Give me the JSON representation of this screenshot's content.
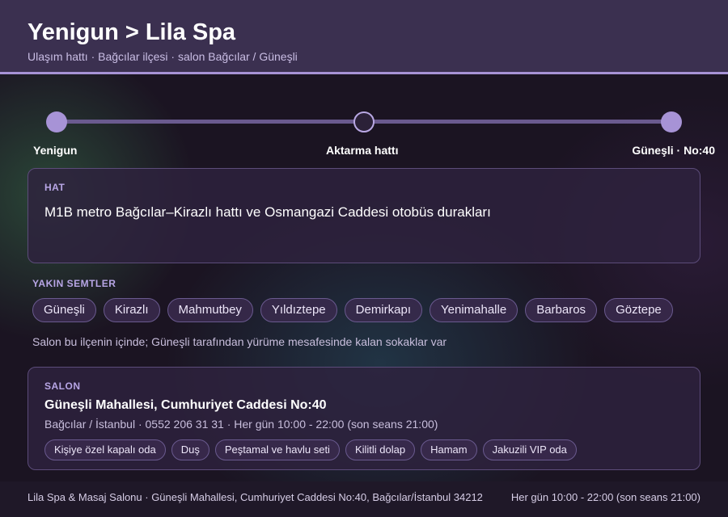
{
  "header": {
    "title": "Yenigun > Lila Spa",
    "subtitle": "Ulaşım hattı · Bağcılar ilçesi · salon Bağcılar / Güneşli"
  },
  "route": {
    "start_label": "Yenigun",
    "middle_label": "Aktarma hattı",
    "end_label": "Güneşli · No:40"
  },
  "line": {
    "label": "HAT",
    "text": "M1B metro Bağcılar–Kirazlı hattı ve Osmangazi Caddesi otobüs durakları"
  },
  "nearby": {
    "label": "YAKIN SEMTLER",
    "items": [
      "Güneşli",
      "Kirazlı",
      "Mahmutbey",
      "Yıldıztepe",
      "Demirkapı",
      "Yenimahalle",
      "Barbaros",
      "Göztepe"
    ],
    "note": "Salon bu ilçenin içinde; Güneşli tarafından yürüme mesafesinde kalan sokaklar var"
  },
  "salon": {
    "label": "SALON",
    "name": "Güneşli Mahallesi, Cumhuriyet Caddesi No:40",
    "meta": "Bağcılar / İstanbul · 0552 206 31 31 · Her gün 10:00 - 22:00 (son seans 21:00)",
    "features": [
      "Kişiye özel kapalı oda",
      "Duş",
      "Peştamal ve havlu seti",
      "Kilitli dolap",
      "Hamam",
      "Jakuzili VIP oda"
    ]
  },
  "footer": {
    "address": "Lila Spa & Masaj Salonu · Güneşli Mahallesi, Cumhuriyet Caddesi No:40, Bağcılar/İstanbul 34212",
    "hours": "Her gün 10:00 - 22:00 (son seans 21:00)"
  },
  "colors": {
    "accent": "#a793d6",
    "header_bg": "#3b3050",
    "card_bg": "#2e223e"
  }
}
